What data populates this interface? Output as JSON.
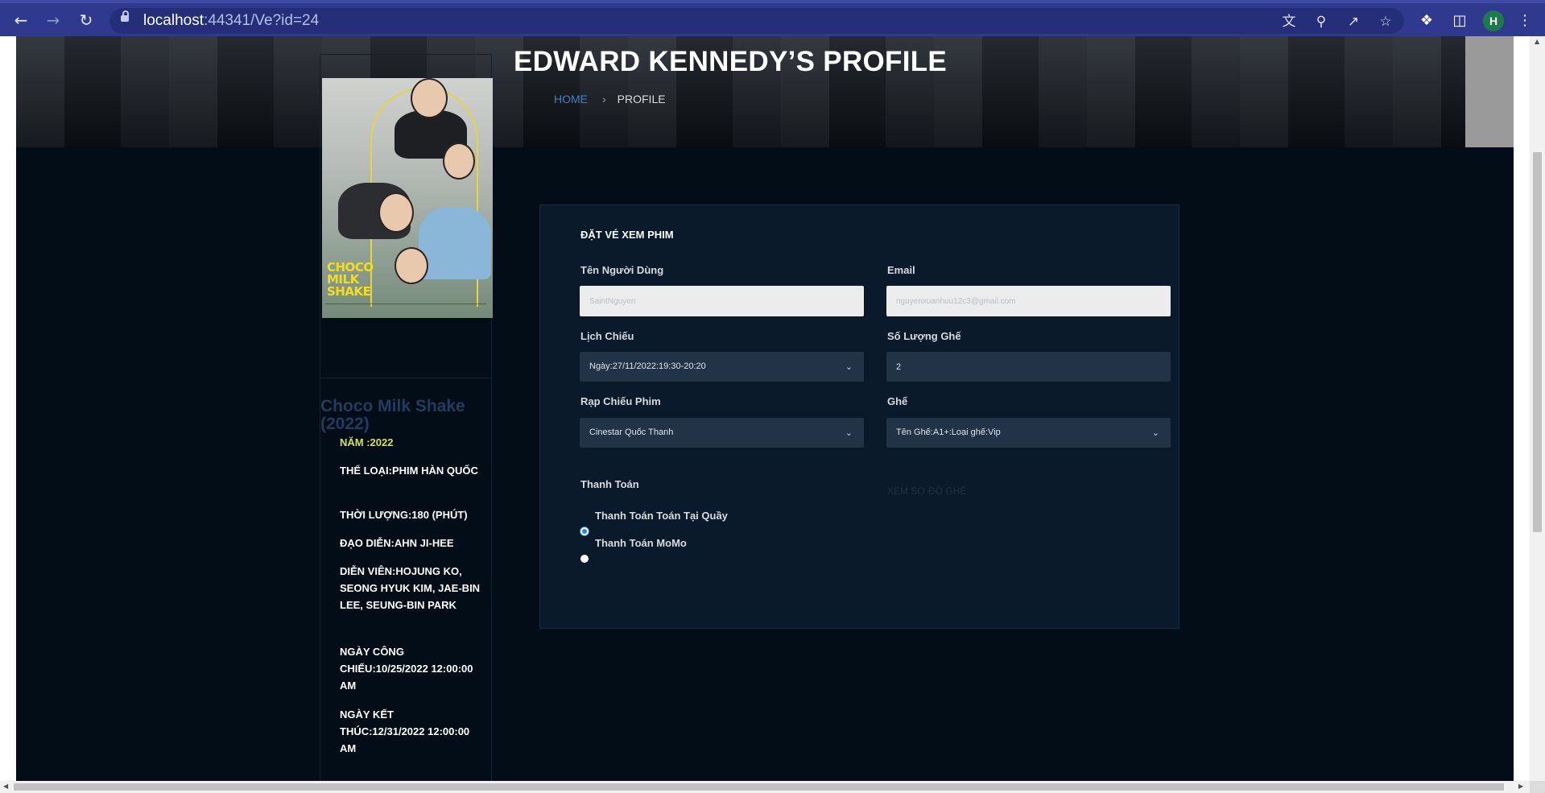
{
  "browser": {
    "url_host": "localhost",
    "url_rest": ":44341/Ve?id=24",
    "profile_initial": "H"
  },
  "header": {
    "title": "EDWARD KENNEDY’S PROFILE",
    "breadcrumb_home": "HOME",
    "breadcrumb_separator": "›",
    "breadcrumb_current": "PROFILE"
  },
  "movie": {
    "title": "Choco Milk Shake (2022)",
    "poster_logo": "CHOCO MILK SHAKE",
    "year": "NĂM :2022",
    "genre": "THỂ LOẠI:PHIM HÀN QUỐC",
    "duration": "THỜI LƯỢNG:180 (PHÚT)",
    "director": "ĐẠO DIỄN:AHN JI-HEE",
    "cast": "DIỄN VIÊN:HOJUNG KO, SEONG HYUK KIM, JAE-BIN LEE, SEUNG-BIN PARK",
    "release_date": "NGÀY CÔNG CHIẾU:10/25/2022 12:00:00 AM",
    "end_date": "NGÀY KẾT THÚC:12/31/2022 12:00:00 AM"
  },
  "booking": {
    "title": "ĐẶT VÉ XEM PHIM",
    "username_label": "Tên Người Dùng",
    "username_placeholder": "SaintNguyen",
    "email_label": "Email",
    "email_placeholder": "nguyenxuanhuu12c3@gmail.com",
    "schedule_label": "Lịch Chiếu",
    "schedule_value": "Ngày:27/11/2022:19:30-20:20",
    "seat_count_label": "Số Lượng Ghế",
    "seat_count_value": "2",
    "cinema_label": "Rạp Chiếu Phim",
    "cinema_value": "Cinestar Quốc Thanh",
    "seat_label": "Ghế",
    "seat_value": "Tên Ghế:A1+:Loại ghế:Vip",
    "seat_map_link": "XEM SƠ ĐỒ GHẾ",
    "payment_label": "Thanh Toán",
    "payment_options": [
      {
        "label": "Thanh Toán Toán Tại Quầy",
        "checked": true
      },
      {
        "label": "Thanh Toán MoMo",
        "checked": false
      }
    ]
  },
  "colors": {
    "page_background": "#020d18",
    "card_background": "#0b1a2b",
    "accent_link": "#4280bf",
    "year_highlight": "#d9e33a",
    "browser_toolbar": "#2f3a8f"
  },
  "icons": [
    "back-arrow-icon",
    "forward-arrow-icon",
    "reload-icon",
    "lock-icon",
    "translate-icon",
    "zoom-icon",
    "share-icon",
    "star-icon",
    "extensions-icon",
    "side-panel-icon",
    "menu-kebab-icon",
    "chevron-right-icon",
    "chevron-down-icon"
  ]
}
